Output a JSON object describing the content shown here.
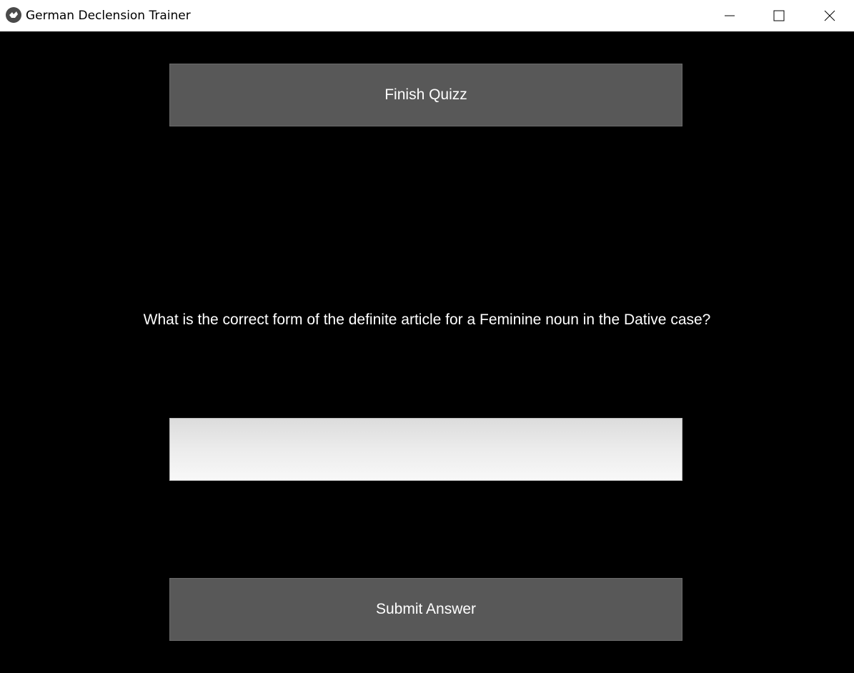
{
  "window": {
    "title": "German Declension Trainer",
    "controls": {
      "minimize": "minimize-icon",
      "maximize": "maximize-icon",
      "close": "close-icon"
    }
  },
  "quiz": {
    "finish_label": "Finish Quizz",
    "question": "What is the correct form of the definite article for a Feminine noun in the Dative case?",
    "answer_value": "",
    "submit_label": "Submit Answer"
  },
  "colors": {
    "background": "#000000",
    "button": "#585858",
    "text": "#ffffff"
  }
}
